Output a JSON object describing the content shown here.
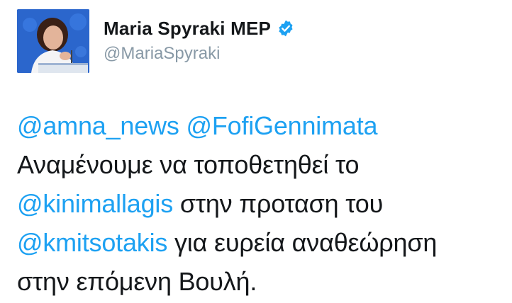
{
  "user": {
    "display_name": "Maria Spyraki MEP",
    "handle": "@MariaSpyraki",
    "verified": true,
    "verified_color": "#1da1f2"
  },
  "avatar": {
    "icon": "profile-photo"
  },
  "tweet": {
    "mention_color": "#1da1f2",
    "text_color": "#14171a",
    "lines": [
      {
        "mention1": "@amna_news",
        "mention2": "@FofiGennimata"
      },
      {
        "text": "Αναμένουμε να τοποθετηθεί το"
      },
      {
        "mention": "@kinimallagis",
        "text": " στην προταση του"
      },
      {
        "mention": "@kmitsotakis",
        "text": " για ευρεία αναθεώρηση"
      },
      {
        "text": "στην επόμενη Βουλή."
      }
    ]
  }
}
